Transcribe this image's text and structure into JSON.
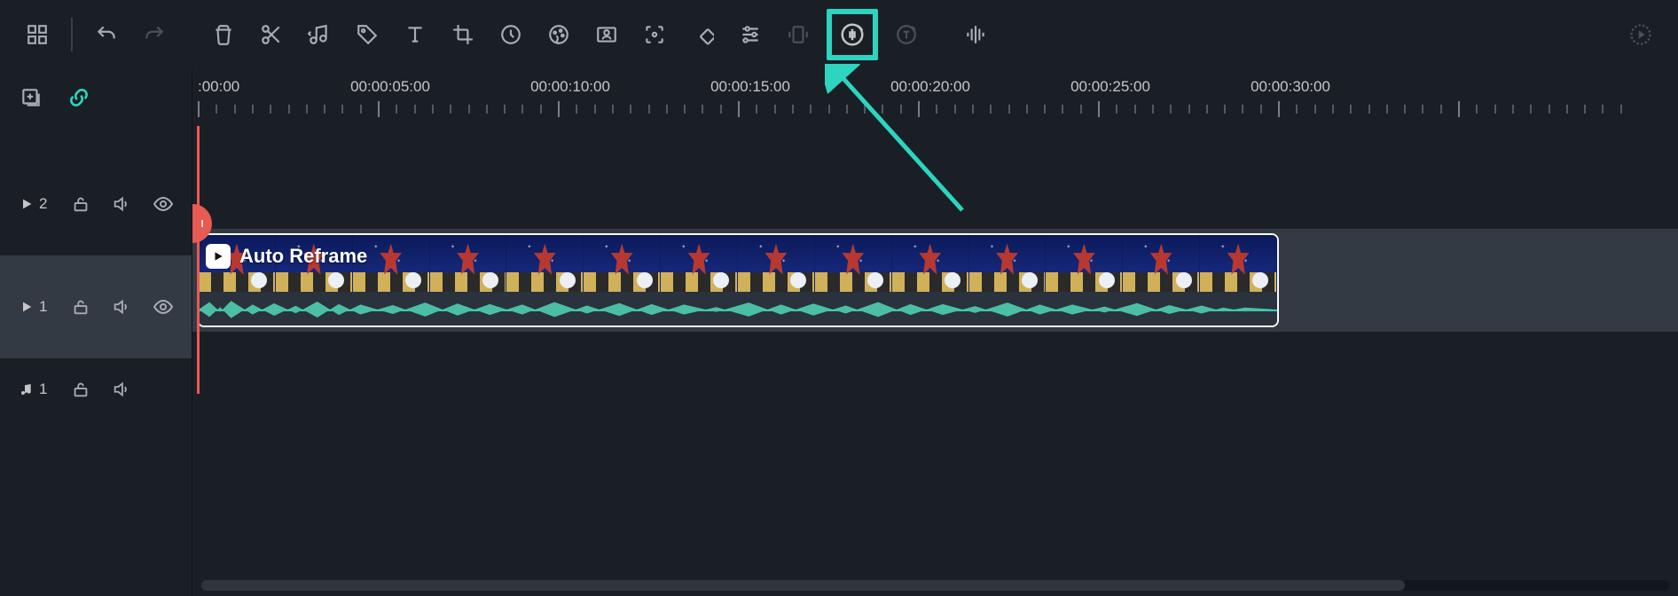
{
  "toolbar": {
    "tools": [
      {
        "name": "layout-grid-icon",
        "interactable": true
      },
      {
        "name": "undo-icon",
        "interactable": true
      },
      {
        "name": "redo-icon",
        "interactable": false
      },
      {
        "name": "delete-icon",
        "interactable": true
      },
      {
        "name": "split-icon",
        "interactable": true
      },
      {
        "name": "detach-audio-icon",
        "interactable": true
      },
      {
        "name": "tag-icon",
        "interactable": true
      },
      {
        "name": "text-icon",
        "interactable": true
      },
      {
        "name": "crop-icon",
        "interactable": true
      },
      {
        "name": "speed-icon",
        "interactable": true
      },
      {
        "name": "color-icon",
        "interactable": true
      },
      {
        "name": "chroma-key-icon",
        "interactable": true
      },
      {
        "name": "smart-focus-icon",
        "interactable": true
      },
      {
        "name": "keyframe-icon",
        "interactable": true
      },
      {
        "name": "adjust-icon",
        "interactable": true
      },
      {
        "name": "auto-reframe-icon",
        "interactable": true
      },
      {
        "name": "audio-denoise-icon",
        "interactable": true,
        "highlighted": true
      },
      {
        "name": "text-to-speech-icon",
        "interactable": false
      },
      {
        "name": "audio-visualizer-icon",
        "interactable": true
      }
    ],
    "render_btn": "render-icon"
  },
  "ruler": {
    "labels": [
      {
        "text": ":00:00",
        "pos": 0
      },
      {
        "text": "00:00:05:00",
        "pos": 203
      },
      {
        "text": "00:00:10:00",
        "pos": 406
      },
      {
        "text": "00:00:15:00",
        "pos": 609
      },
      {
        "text": "00:00:20:00",
        "pos": 812
      },
      {
        "text": "00:00:25:00",
        "pos": 1015
      },
      {
        "text": "00:00:30:00",
        "pos": 1218
      }
    ],
    "spacing": 203
  },
  "tracks": {
    "video2": {
      "label": "2",
      "type": "video"
    },
    "video1": {
      "label": "1",
      "type": "video"
    },
    "audio1": {
      "label": "1",
      "type": "audio"
    }
  },
  "clip": {
    "label": "Auto Reframe"
  }
}
